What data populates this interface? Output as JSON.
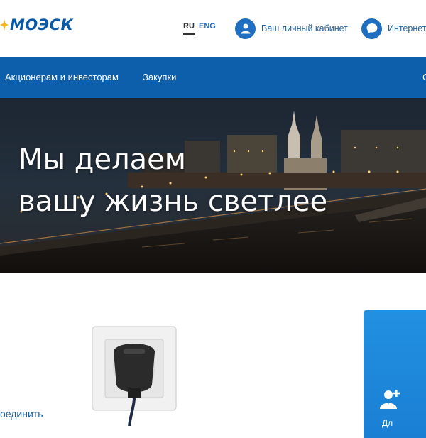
{
  "header": {
    "logo_text": "МОЭСК",
    "lang_ru": "RU",
    "lang_eng": "ENG",
    "cabinet_label": "Ваш личный кабинет",
    "internet_label": "Интернет"
  },
  "nav": {
    "items": [
      "Акционерам и инвесторам",
      "Закупки",
      "С"
    ]
  },
  "hero": {
    "line1": "Мы делаем",
    "line2": "вашу жизнь светлее"
  },
  "content": {
    "connect_label": "оединить",
    "card_label": "Дл"
  },
  "colors": {
    "brand_blue": "#0d5fac",
    "accent_blue": "#1e6fc1",
    "card_blue": "#1a7fd4"
  }
}
